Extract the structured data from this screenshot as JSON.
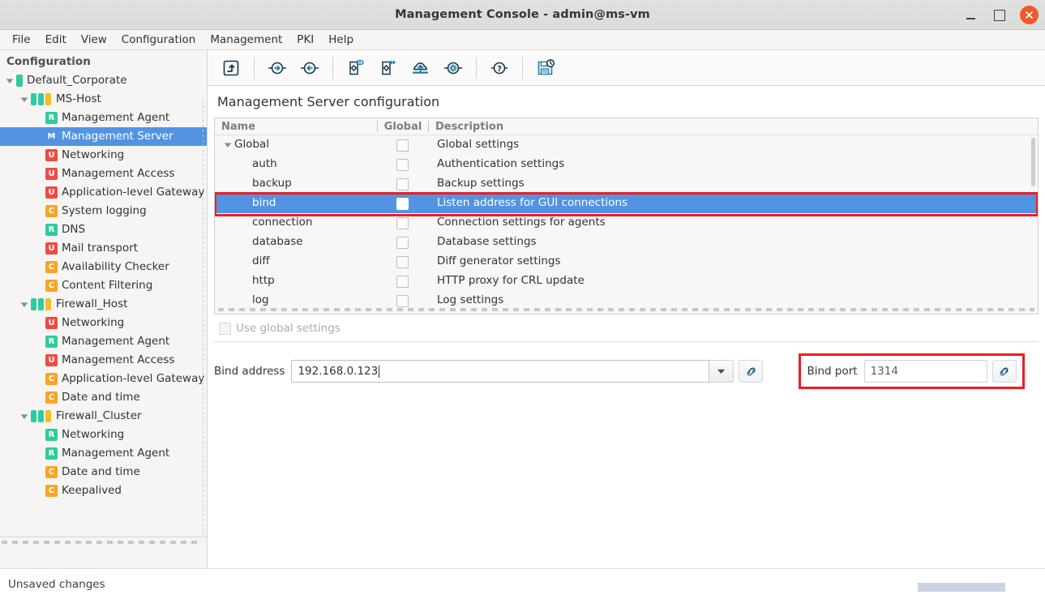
{
  "window": {
    "title": "Management Console - admin@ms-vm",
    "controls": {
      "minimize": "–",
      "maximize": "□",
      "close": "×"
    }
  },
  "menubar": {
    "items": [
      {
        "label": "File"
      },
      {
        "label": "Edit"
      },
      {
        "label": "View"
      },
      {
        "label": "Configuration"
      },
      {
        "label": "Management"
      },
      {
        "label": "PKI"
      },
      {
        "label": "Help"
      }
    ]
  },
  "sidebar": {
    "header": "Configuration",
    "tree": [
      {
        "label": "Default_Corporate",
        "indent": 0,
        "twisty": "down",
        "icon": "single-bar-green",
        "selected": false
      },
      {
        "label": "MS-Host",
        "indent": 1,
        "twisty": "down",
        "icon": "bars-gog",
        "selected": false
      },
      {
        "label": "Management Agent",
        "indent": 2,
        "twisty": "none",
        "icon": "badge-R-green",
        "selected": false
      },
      {
        "label": "Management Server",
        "indent": 2,
        "twisty": "none",
        "icon": "badge-M-blue",
        "selected": true
      },
      {
        "label": "Networking",
        "indent": 2,
        "twisty": "none",
        "icon": "badge-U-red",
        "selected": false
      },
      {
        "label": "Management Access",
        "indent": 2,
        "twisty": "none",
        "icon": "badge-U-red",
        "selected": false
      },
      {
        "label": "Application-level Gateway",
        "indent": 2,
        "twisty": "none",
        "icon": "badge-U-red",
        "selected": false
      },
      {
        "label": "System logging",
        "indent": 2,
        "twisty": "none",
        "icon": "badge-C-orange",
        "selected": false
      },
      {
        "label": "DNS",
        "indent": 2,
        "twisty": "none",
        "icon": "badge-R-green",
        "selected": false
      },
      {
        "label": "Mail transport",
        "indent": 2,
        "twisty": "none",
        "icon": "badge-U-red",
        "selected": false
      },
      {
        "label": "Availability Checker",
        "indent": 2,
        "twisty": "none",
        "icon": "badge-C-orange",
        "selected": false
      },
      {
        "label": "Content Filtering",
        "indent": 2,
        "twisty": "none",
        "icon": "badge-C-orange",
        "selected": false
      },
      {
        "label": "Firewall_Host",
        "indent": 1,
        "twisty": "down",
        "icon": "bars-gog",
        "selected": false
      },
      {
        "label": "Networking",
        "indent": 2,
        "twisty": "none",
        "icon": "badge-U-red",
        "selected": false
      },
      {
        "label": "Management Agent",
        "indent": 2,
        "twisty": "none",
        "icon": "badge-R-green",
        "selected": false
      },
      {
        "label": "Management Access",
        "indent": 2,
        "twisty": "none",
        "icon": "badge-U-red",
        "selected": false
      },
      {
        "label": "Application-level Gateway",
        "indent": 2,
        "twisty": "none",
        "icon": "badge-C-orange",
        "selected": false
      },
      {
        "label": "Date and time",
        "indent": 2,
        "twisty": "none",
        "icon": "badge-C-orange",
        "selected": false
      },
      {
        "label": "Firewall_Cluster",
        "indent": 1,
        "twisty": "down",
        "icon": "bars-gog",
        "selected": false
      },
      {
        "label": "Networking",
        "indent": 2,
        "twisty": "none",
        "icon": "badge-R-green",
        "selected": false
      },
      {
        "label": "Management Agent",
        "indent": 2,
        "twisty": "none",
        "icon": "badge-R-green",
        "selected": false
      },
      {
        "label": "Date and time",
        "indent": 2,
        "twisty": "none",
        "icon": "badge-C-orange",
        "selected": false
      },
      {
        "label": "Keepalived",
        "indent": 2,
        "twisty": "none",
        "icon": "badge-C-orange",
        "selected": false
      }
    ]
  },
  "toolbar": {
    "buttons": [
      {
        "name": "go-up-icon",
        "tooltip": "Up one level"
      },
      {
        "name": "arrow-right-circle-icon",
        "tooltip": "Forward"
      },
      {
        "name": "arrow-left-circle-icon",
        "tooltip": "Back"
      },
      {
        "name": "config-preview-icon",
        "tooltip": "Preview configuration"
      },
      {
        "name": "config-transfer-icon",
        "tooltip": "Transfer configuration"
      },
      {
        "name": "upload-cloud-icon",
        "tooltip": "Upload"
      },
      {
        "name": "gear-circle-icon",
        "tooltip": "Settings"
      },
      {
        "name": "help-circle-icon",
        "tooltip": "Help"
      },
      {
        "name": "save-history-icon",
        "tooltip": "Save with history"
      }
    ]
  },
  "main": {
    "page_title": "Management Server configuration",
    "table": {
      "columns": [
        "Name",
        "Global",
        "Description"
      ],
      "rows": [
        {
          "name": "Global",
          "indent": 0,
          "twisty": "down",
          "global_checked": false,
          "description": "Global settings",
          "selected": false
        },
        {
          "name": "auth",
          "indent": 1,
          "twisty": "none",
          "global_checked": false,
          "description": "Authentication settings",
          "selected": false
        },
        {
          "name": "backup",
          "indent": 1,
          "twisty": "none",
          "global_checked": false,
          "description": "Backup settings",
          "selected": false
        },
        {
          "name": "bind",
          "indent": 1,
          "twisty": "none",
          "global_checked": false,
          "description": "Listen address for GUI connections",
          "selected": true
        },
        {
          "name": "connection",
          "indent": 1,
          "twisty": "none",
          "global_checked": false,
          "description": "Connection settings for agents",
          "selected": false
        },
        {
          "name": "database",
          "indent": 1,
          "twisty": "none",
          "global_checked": false,
          "description": "Database settings",
          "selected": false
        },
        {
          "name": "diff",
          "indent": 1,
          "twisty": "none",
          "global_checked": false,
          "description": "Diff generator settings",
          "selected": false
        },
        {
          "name": "http",
          "indent": 1,
          "twisty": "none",
          "global_checked": false,
          "description": "HTTP proxy for CRL update",
          "selected": false
        },
        {
          "name": "log",
          "indent": 1,
          "twisty": "none",
          "global_checked": false,
          "description": "Log settings",
          "selected": false
        }
      ]
    },
    "form": {
      "use_global_label": "Use global settings",
      "use_global_checked": false,
      "use_global_enabled": false,
      "bind_address_label": "Bind address",
      "bind_address_value": "192.168.0.123",
      "bind_address_placeholder": "",
      "bind_port_label": "Bind port",
      "bind_port_value": "1314",
      "bind_port_placeholder": "",
      "link_button_name": "chain-link-icon"
    }
  },
  "statusbar": {
    "message": "Unsaved changes",
    "progress_percent": 100
  },
  "annotations": {
    "accent_red": "#ee1c25",
    "selection_blue": "#5294e2",
    "items": [
      {
        "target": "table-row-bind",
        "type": "rect"
      },
      {
        "target": "bind-port-group",
        "type": "rect"
      }
    ]
  }
}
